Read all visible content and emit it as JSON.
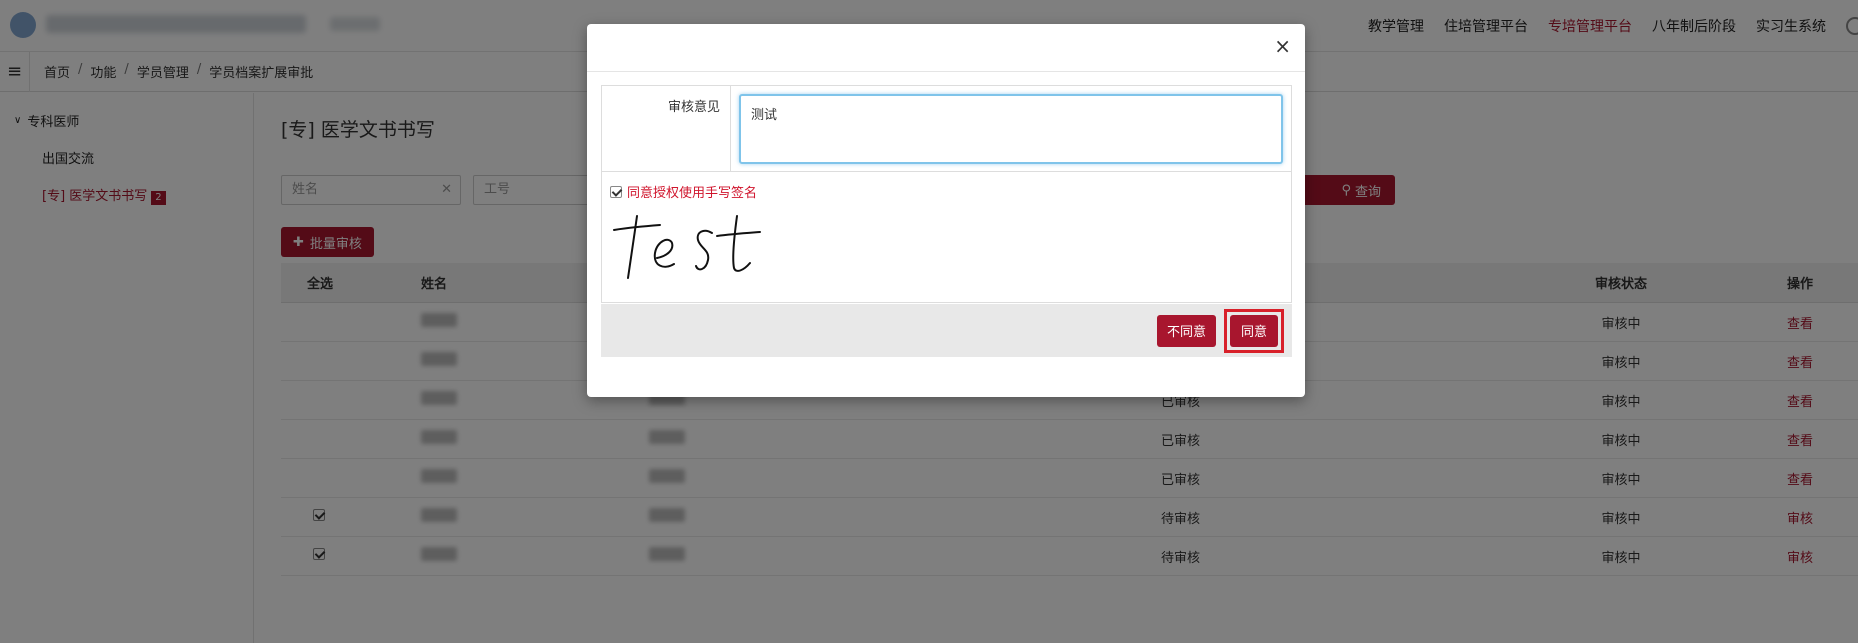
{
  "topnav": {
    "items": [
      {
        "label": "教学管理",
        "active": false
      },
      {
        "label": "住培管理平台",
        "active": false
      },
      {
        "label": "专培管理平台",
        "active": true
      },
      {
        "label": "八年制后阶段",
        "active": false
      },
      {
        "label": "实习生系统",
        "active": false
      }
    ]
  },
  "breadcrumb": [
    "首页",
    "功能",
    "学员管理",
    "学员档案扩展审批"
  ],
  "sidebar": {
    "group": "专科医师",
    "items": [
      {
        "label": "出国交流",
        "active": false,
        "badge": ""
      },
      {
        "label": "[专] 医学文书书写",
        "active": true,
        "badge": "2"
      }
    ]
  },
  "main": {
    "title": "[专] 医学文书书写",
    "filters": {
      "name_placeholder": "姓名",
      "id_placeholder": "工号"
    },
    "query_label": "查询",
    "batch_label": "批量审核",
    "columns": [
      "全选",
      "姓名",
      "",
      "",
      "审核状态",
      "操作"
    ],
    "rows": [
      {
        "checked": false,
        "status_a": "",
        "status_b": "审核中",
        "action": "查看"
      },
      {
        "checked": false,
        "status_a": "",
        "status_b": "审核中",
        "action": "查看"
      },
      {
        "checked": false,
        "status_a": "已审核",
        "status_b": "审核中",
        "action": "查看"
      },
      {
        "checked": false,
        "status_a": "已审核",
        "status_b": "审核中",
        "action": "查看"
      },
      {
        "checked": false,
        "status_a": "已审核",
        "status_b": "审核中",
        "action": "查看"
      },
      {
        "checked": true,
        "status_a": "待审核",
        "status_b": "审核中",
        "action": "审核"
      },
      {
        "checked": true,
        "status_a": "待审核",
        "status_b": "审核中",
        "action": "审核"
      }
    ]
  },
  "modal": {
    "close": "×",
    "opinion_label": "审核意见",
    "opinion_value": "测试",
    "sign_consent": "同意授权使用手写签名",
    "disagree_label": "不同意",
    "agree_label": "同意"
  },
  "colors": {
    "brand": "#a8162e",
    "highlight": "#d8202a"
  }
}
